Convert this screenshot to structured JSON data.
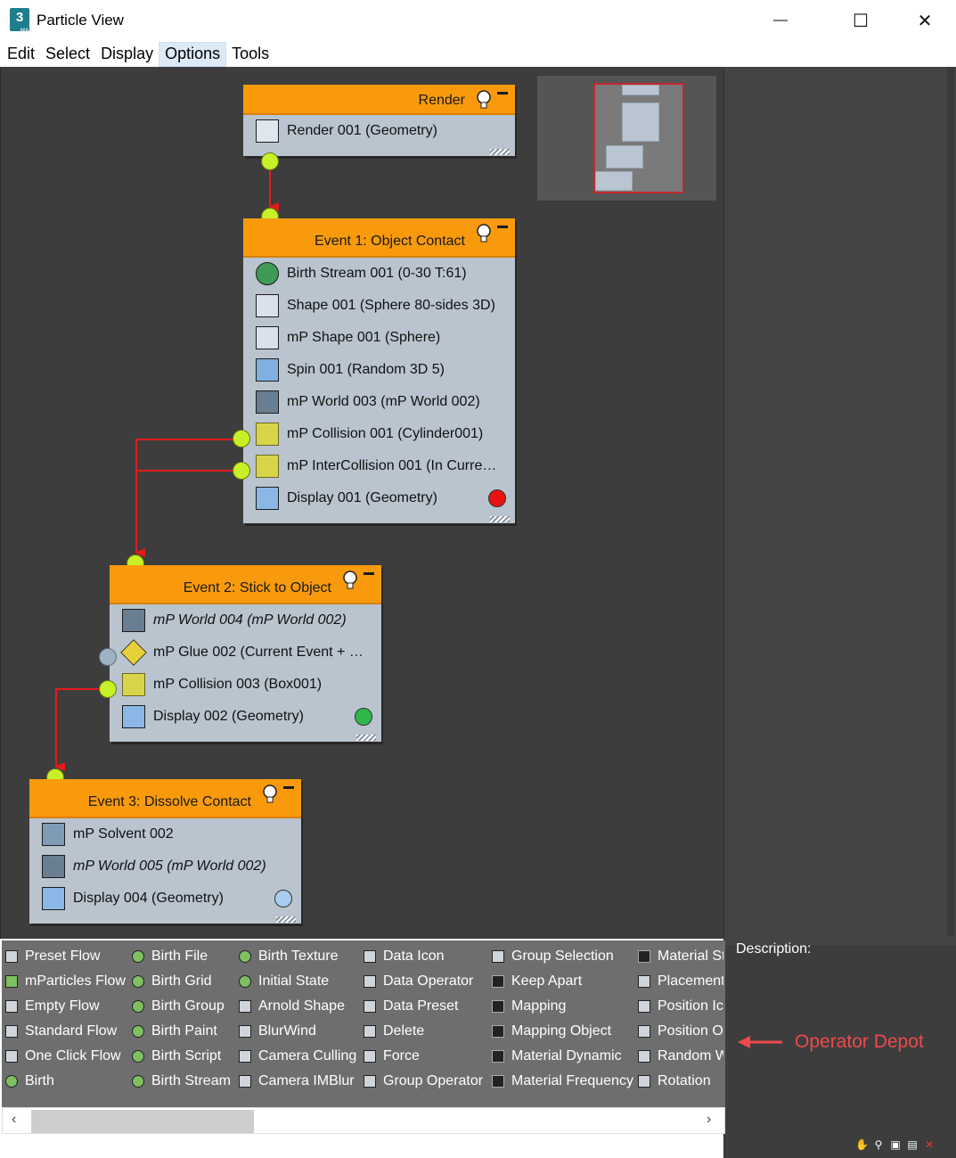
{
  "window": {
    "title": "Particle View",
    "app_icon": "3ds-max-icon",
    "app_icon_text": "3",
    "app_icon_sub": "MAX"
  },
  "window_controls": {
    "minimize": "—",
    "maximize": "☐",
    "close": "✕"
  },
  "menu": [
    "Edit",
    "Select",
    "Display",
    "Options",
    "Tools"
  ],
  "nodes": {
    "render": {
      "title": "Render",
      "rows": [
        {
          "label": "Render 001 (Geometry)",
          "icon": "teapot-icon"
        }
      ]
    },
    "event1": {
      "title": "Event 1: Object Contact",
      "rows": [
        {
          "label": "Birth Stream 001 (0-30 T:61)",
          "icon": "birth-stream-icon"
        },
        {
          "label": "Shape 001 (Sphere 80-sides 3D)",
          "icon": "shape-icon"
        },
        {
          "label": "mP Shape 001 (Sphere)",
          "icon": "mp-shape-icon"
        },
        {
          "label": "Spin 001 (Random 3D 5)",
          "icon": "spin-icon"
        },
        {
          "label": "mP World 003 (mP World 002)",
          "icon": "mp-world-icon"
        },
        {
          "label": "mP Collision 001 (Cylinder001)",
          "icon": "mp-collision-icon"
        },
        {
          "label": "mP InterCollision 001 (In Curren…",
          "icon": "mp-intercollision-icon"
        },
        {
          "label": "Display 001 (Geometry)",
          "icon": "display-icon"
        }
      ],
      "display_color": "#e81212"
    },
    "event2": {
      "title": "Event 2: Stick to Object",
      "rows": [
        {
          "label": "mP World 004 (mP World 002)",
          "icon": "mp-world-icon",
          "italic": true
        },
        {
          "label": "mP Glue 002 (Current Event + …",
          "icon": "mp-glue-icon"
        },
        {
          "label": "mP Collision 003 (Box001)",
          "icon": "mp-collision-icon"
        },
        {
          "label": "Display 002 (Geometry)",
          "icon": "display-icon"
        }
      ],
      "display_color": "#2fb84a"
    },
    "event3": {
      "title": "Event 3: Dissolve Contact",
      "rows": [
        {
          "label": "mP Solvent 002",
          "icon": "mp-solvent-icon"
        },
        {
          "label": "mP World 005 (mP World 002)",
          "icon": "mp-world-icon",
          "italic": true
        },
        {
          "label": "Display 004 (Geometry)",
          "icon": "display-icon"
        }
      ],
      "display_color": "#a9cdf0"
    }
  },
  "depot": {
    "columns": [
      [
        "Preset Flow",
        "mParticles Flow",
        "Empty Flow",
        "Standard Flow",
        "One Click Flow",
        "Birth"
      ],
      [
        "Birth File",
        "Birth Grid",
        "Birth Group",
        "Birth Paint",
        "Birth Script",
        "Birth Stream"
      ],
      [
        "Birth Texture",
        "Initial State",
        "Arnold Shape",
        "BlurWind",
        "Camera Culling",
        "Camera IMBlur"
      ],
      [
        "Data Icon",
        "Data Operator",
        "Data Preset",
        "Delete",
        "Force",
        "Group Operator"
      ],
      [
        "Group Selection",
        "Keep Apart",
        "Mapping",
        "Mapping Object",
        "Material Dynamic",
        "Material Frequency"
      ],
      [
        "Material St",
        "Placement",
        "Position Ic",
        "Position O",
        "Random W",
        "Rotation"
      ]
    ],
    "scroll_left": "‹",
    "scroll_right": "›"
  },
  "description_label": "Description:",
  "annotation": {
    "label": "Operator Depot",
    "color": "#f0484a"
  },
  "status_icons": [
    "pan-icon",
    "zoom-icon",
    "zoom-region-icon",
    "zoom-extents-icon",
    "no-zoom-icon"
  ]
}
